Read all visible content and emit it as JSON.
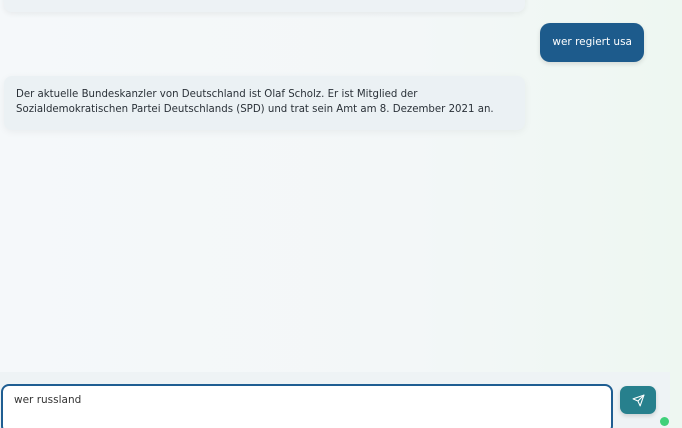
{
  "conversation": {
    "user_message": "wer regiert usa",
    "bot_message": "Der aktuelle Bundeskanzler von Deutschland ist Olaf Scholz. Er ist Mitglied der Sozialdemokratischen Partei Deutschlands (SPD) und trat sein Amt am 8. Dezember 2021 an."
  },
  "composer": {
    "input_value": "wer russland",
    "send_icon": "send-icon"
  },
  "colors": {
    "user_bubble": "#1d5b8c",
    "send_button": "#27808d",
    "status_online": "#3fd07a"
  }
}
